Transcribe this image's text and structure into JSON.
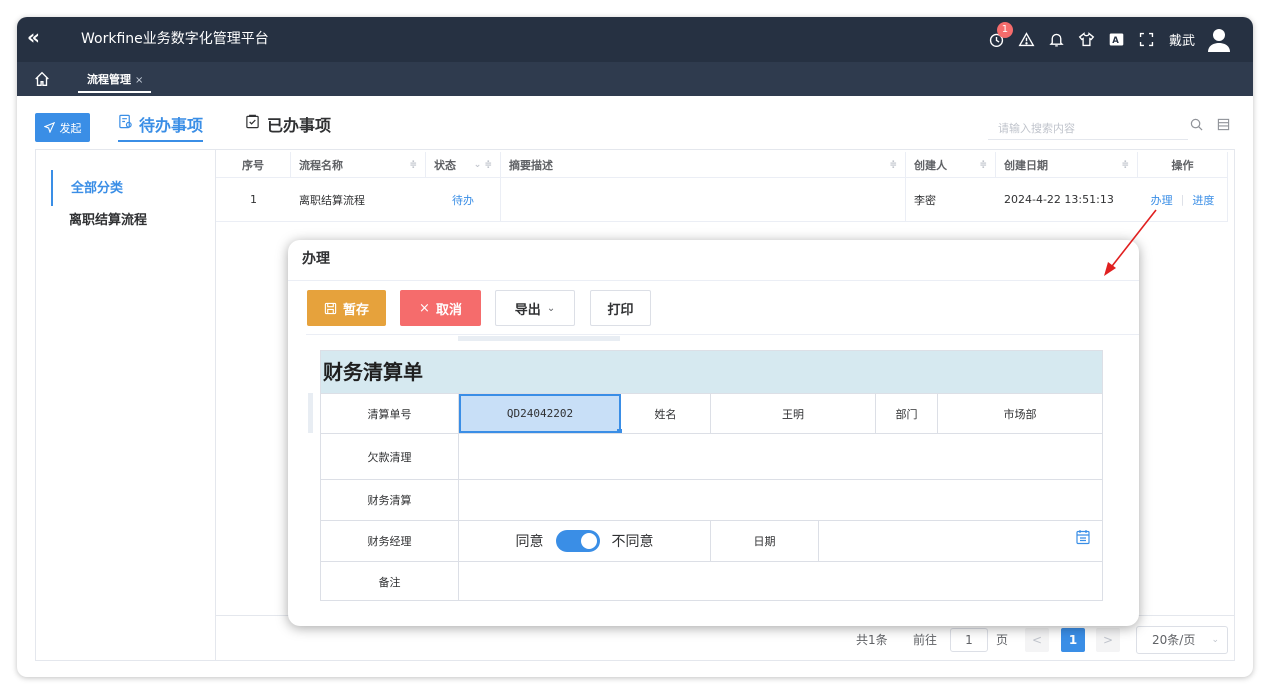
{
  "app": {
    "title": "Workfine业务数字化管理平台",
    "collapse_glyph": "«"
  },
  "topbar": {
    "badge_count": "1",
    "username": "戴武",
    "font_icon_label": "A"
  },
  "tabs": [
    {
      "label": "流程管理",
      "close": "×"
    }
  ],
  "toolbar": {
    "start_label": "发起",
    "tab_todo": "待办事项",
    "tab_done": "已办事项",
    "search_placeholder": "请输入搜索内容"
  },
  "leftnav": {
    "items": [
      {
        "label": "全部分类"
      },
      {
        "label": "离职结算流程"
      }
    ]
  },
  "grid": {
    "headers": [
      "序号",
      "流程名称",
      "状态",
      "摘要描述",
      "创建人",
      "创建日期",
      "操作"
    ],
    "rows": [
      {
        "index": "1",
        "name": "离职结算流程",
        "status": "待办",
        "summary": "",
        "creator": "李密",
        "date": "2024-4-22 13:51:13",
        "action_handle": "办理",
        "action_progress": "进度"
      }
    ]
  },
  "pager": {
    "total": "共1条",
    "goto": "前往",
    "page_input": "1",
    "page_unit": "页",
    "prev": "<",
    "current": "1",
    "next": ">",
    "size": "20条/页"
  },
  "dialog": {
    "title": "办理",
    "buttons": {
      "save": "暂存",
      "cancel": "取消",
      "export": "导出",
      "print": "打印"
    },
    "form": {
      "title": "财务清算单",
      "labels": {
        "order_no": "清算单号",
        "name": "姓名",
        "dept": "部门",
        "debt": "欠款清理",
        "finance": "财务清算",
        "manager": "财务经理",
        "date": "日期",
        "remark": "备注"
      },
      "values": {
        "order_no": "QD24042202",
        "name": "王明",
        "dept": "市场部"
      },
      "approval": {
        "agree": "同意",
        "disagree": "不同意"
      }
    }
  },
  "colors": {
    "topbar": "#263142",
    "accent": "#3a8ee6",
    "warning": "#e6a23c",
    "danger": "#f56c6c",
    "form_header": "#d6e9f0",
    "arrow": "#e02020"
  }
}
